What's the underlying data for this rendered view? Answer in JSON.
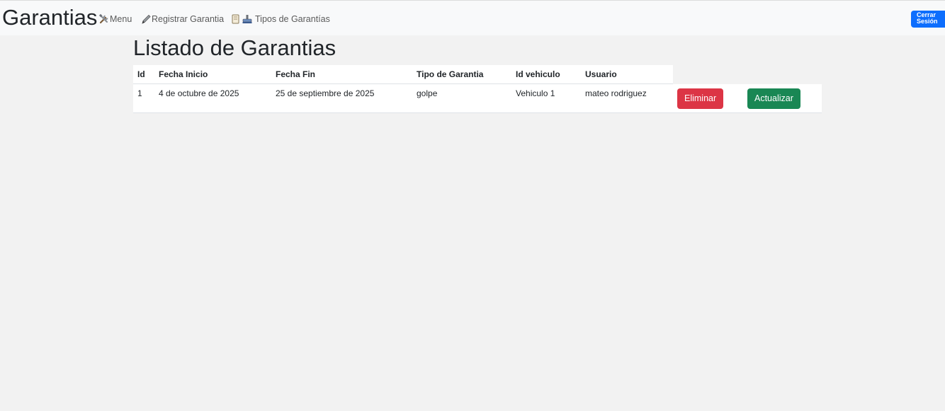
{
  "navbar": {
    "brand": "Garantias",
    "menu_label": "Menu",
    "menu_icon": "tools-icon",
    "register_label": "Registrar Garantia",
    "register_icon": "pencil-icon",
    "types_label": "Tipos de Garantías",
    "types_icons": [
      "scroll-icon",
      "stamp-icon"
    ],
    "logout_line1": "Cerrar",
    "logout_line2": "Sesión"
  },
  "main": {
    "title": "Listado de Garantias",
    "columns": [
      "Id",
      "Fecha Inicio",
      "Fecha Fin",
      "Tipo de Garantia",
      "Id vehiculo",
      "Usuario"
    ],
    "rows": [
      {
        "id": "1",
        "fecha_inicio": "4 de octubre de 2025",
        "fecha_fin": "25 de septiembre de 2025",
        "tipo": "golpe",
        "vehiculo": "Vehiculo 1",
        "usuario": "mateo rodriguez",
        "delete_label": "Eliminar",
        "update_label": "Actualizar"
      }
    ]
  },
  "colors": {
    "primary": "#0d6efd",
    "danger": "#dc3545",
    "success": "#198754",
    "navbar_bg": "#f8f9fa",
    "page_bg": "#f2f2f2"
  }
}
